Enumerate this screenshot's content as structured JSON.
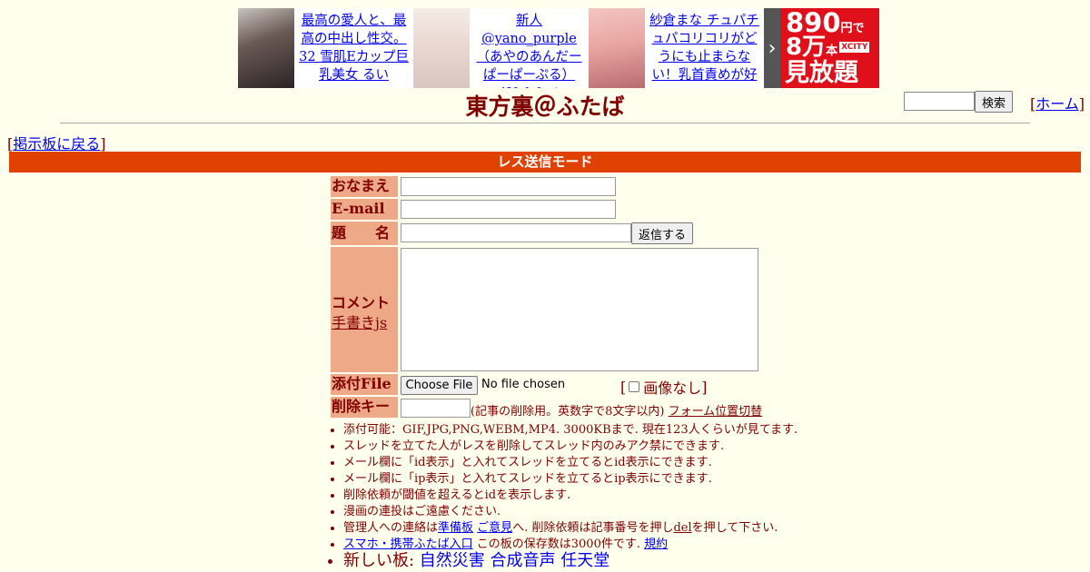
{
  "ads": [
    {
      "text": "最高の愛人と、最高の中出し性交。32 雪肌Eカップ巨乳美女 るい"
    },
    {
      "text": "新人 @yano_purple（あやのあんだーぱーぱーぷる） AV debut"
    },
    {
      "text": "紗倉まな チュパチュパコリコリがどうにも止まらない！乳首責めが好"
    }
  ],
  "banner": {
    "price": "890",
    "price_unit": "円で",
    "count": "8万",
    "count_unit": "本",
    "brand": "XCITY",
    "tagline": "見放題",
    "arrow": "›"
  },
  "title": "東方裏＠ふたば",
  "search": {
    "button": "検索",
    "value": ""
  },
  "home": {
    "open": "[",
    "link": "ホーム",
    "close": "]"
  },
  "back": {
    "open": "[",
    "link": "掲示板に戻る",
    "close": "]"
  },
  "mode_bar": "レス送信モード",
  "form": {
    "name_label": "おなまえ",
    "email_label": "E-mail",
    "subject_label": "題　　名",
    "submit": "返信する",
    "comment_label": "コメント",
    "draw_link": "手書きjs",
    "file_label": "添付File",
    "file_button": "Choose File",
    "file_status": "No file chosen",
    "noimage_open": "[",
    "noimage_label": "画像なし",
    "noimage_close": "]",
    "delkey_label": "削除キー",
    "delkey_note": "(記事の削除用。英数字で8文字以内)",
    "form_toggle": "フォーム位置切替"
  },
  "notes": [
    "添付可能：GIF,JPG,PNG,WEBM,MP4. 3000KBまで. 現在123人くらいが見てます.",
    "スレッドを立てた人がレスを削除してスレッド内のみアク禁にできます.",
    "メール欄に「id表示」と入れてスレッドを立てるとid表示にできます.",
    "メール欄に「ip表示」と入れてスレッドを立てるとip表示にできます.",
    "削除依頼が閾値を超えるとidを表示します.",
    "漫画の連投はご遠慮ください."
  ],
  "contact": {
    "pre": "管理人への連絡は",
    "link1": "準備板",
    "link2": "ご意見",
    "mid": "へ. 削除依頼は記事番号を押し",
    "del": "del",
    "post": "を押して下さい."
  },
  "mobile": {
    "link": "スマホ・携帯ふたば入口",
    "text": " この板の保存数は3000件です. ",
    "rules": "規約"
  },
  "new_boards": {
    "label": "新しい板: ",
    "boards": [
      "自然災害",
      "合成音声",
      "任天堂"
    ]
  }
}
